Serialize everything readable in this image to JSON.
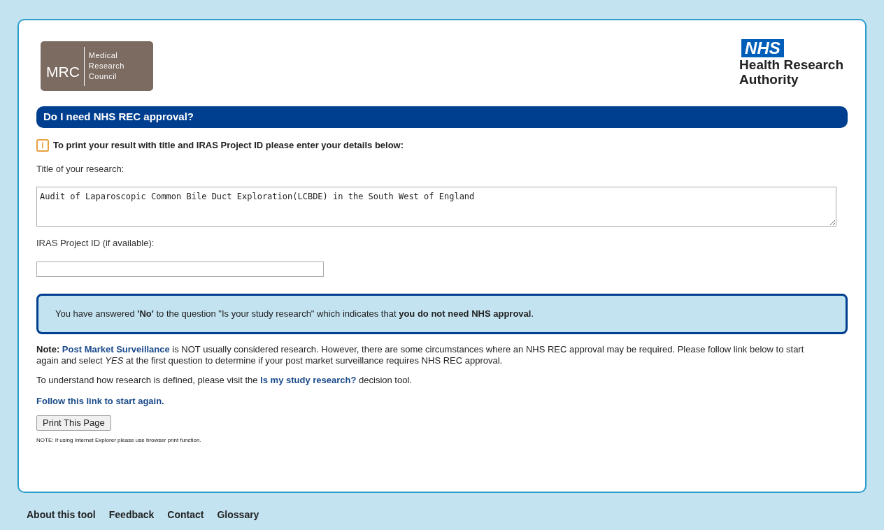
{
  "logos": {
    "mrc": {
      "initials": "MRC",
      "lines": [
        "Medical",
        "Research",
        "Council"
      ]
    },
    "nhs": {
      "badge": "NHS",
      "lines": [
        "Health Research",
        "Authority"
      ]
    }
  },
  "heading": "Do I need NHS REC approval?",
  "info": {
    "icon": "i",
    "text": "To print your result with title and IRAS Project ID please enter your details below:"
  },
  "fields": [
    {
      "label": "Title of your research:",
      "kind": "textarea",
      "value": "Audit of Laparoscopic Common Bile Duct Exploration(LCBDE) in the South West of England"
    },
    {
      "label": "IRAS Project ID (if available):",
      "kind": "input"
    }
  ],
  "result": "You have answered **'No'** to the question \"Is your study research\" which indicates that **you do not need NHS approval**.",
  "paragraphs": [
    [
      {
        "kind": "text",
        "text": "**Note:** "
      },
      {
        "kind": "link",
        "text": "Post Market Surveillance"
      },
      {
        "kind": "text",
        "text": " is NOT usually considered research. However, there are some circumstances where an NHS REC approval may be required. Please follow link below to start again and select *YES* at the first question to determine if your post market surveillance requires NHS REC approval."
      }
    ],
    [
      {
        "kind": "text",
        "text": "To understand how research is defined, please visit the "
      },
      {
        "kind": "link",
        "text": "Is my study research?"
      },
      {
        "kind": "text",
        "text": " decision tool."
      }
    ]
  ],
  "restart_link": "Follow this link to start again.",
  "print_button": "Print This Page",
  "print_note": "NOTE: If using Internet Explorer please use browser print function.",
  "footer_links": [
    "About this tool",
    "Feedback",
    "Contact",
    "Glossary"
  ]
}
